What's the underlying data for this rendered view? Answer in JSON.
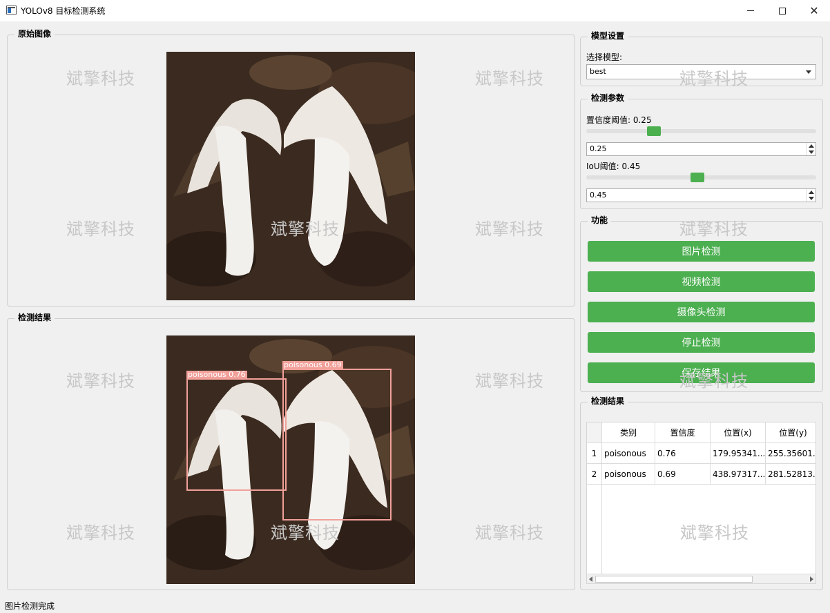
{
  "window": {
    "title": "YOLOv8 目标检测系统"
  },
  "watermark": "斌擎科技",
  "panels": {
    "original": {
      "title": "原始图像"
    },
    "result": {
      "title": "检测结果"
    }
  },
  "detections": [
    {
      "label": "poisonous",
      "confidence": "0.76"
    },
    {
      "label": "poisonous",
      "confidence": "0.69"
    }
  ],
  "model_settings": {
    "title": "模型设置",
    "select_label": "选择模型:",
    "selected_model": "best"
  },
  "detection_params": {
    "title": "检测参数",
    "conf_label": "置信度阈值: 0.25",
    "conf_slider_fraction": 0.25,
    "conf_value": "0.25",
    "iou_label": "IoU阈值: 0.45",
    "iou_slider_fraction": 0.45,
    "iou_value": "0.45"
  },
  "functions": {
    "title": "功能",
    "buttons": [
      "图片检测",
      "视频检测",
      "摄像头检测",
      "停止检测",
      "保存结果"
    ]
  },
  "results_table": {
    "title": "检测结果",
    "columns": [
      "类别",
      "置信度",
      "位置(x)",
      "位置(y)"
    ],
    "rows": [
      {
        "index": "1",
        "cells": [
          "poisonous",
          "0.76",
          "179.95341...",
          "255.35601..."
        ]
      },
      {
        "index": "2",
        "cells": [
          "poisonous",
          "0.69",
          "438.97317...",
          "281.52813..."
        ]
      }
    ]
  },
  "status_bar": {
    "text": "图片检测完成"
  },
  "colors": {
    "accent": "#4caf50",
    "box": "#f2a09a"
  }
}
